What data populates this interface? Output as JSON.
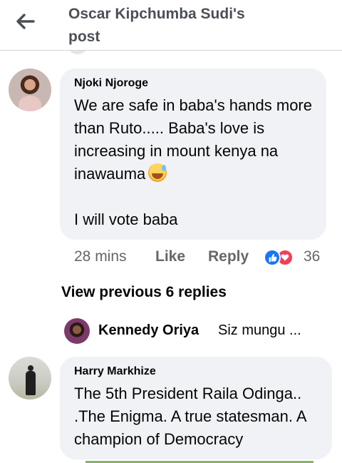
{
  "header": {
    "title_line1": "Oscar Kipchumba Sudi's",
    "title_line2": "post",
    "back_icon": "arrow-left-icon"
  },
  "comments": [
    {
      "author": "Njoki Njoroge",
      "text_before_emoji": "We are safe in baba's hands more than Ruto..... Baba's love is increasing in mount kenya na inawauma",
      "emoji": "sweat-smile-emoji",
      "text_after_emoji": "I will vote baba",
      "time": "28 mins",
      "like_label": "Like",
      "reply_label": "Reply",
      "reaction_icons": [
        "like-reaction-icon",
        "love-reaction-icon"
      ],
      "reaction_count": "36"
    },
    {
      "author": "Harry Markhize",
      "text": "The 5th President Raila Odinga.. .The Enigma. A true statesman. A champion of Democracy"
    }
  ],
  "replies": {
    "view_previous_label": "View previous 6 replies",
    "latest": {
      "author": "Kennedy Oriya",
      "snippet": "Siz mungu ..."
    }
  },
  "colors": {
    "bubble": "#f0f2f5",
    "meta_text": "#65676b",
    "header_text": "#4b4f56",
    "like_blue": "#1877f2",
    "love_red": "#f33e58"
  }
}
